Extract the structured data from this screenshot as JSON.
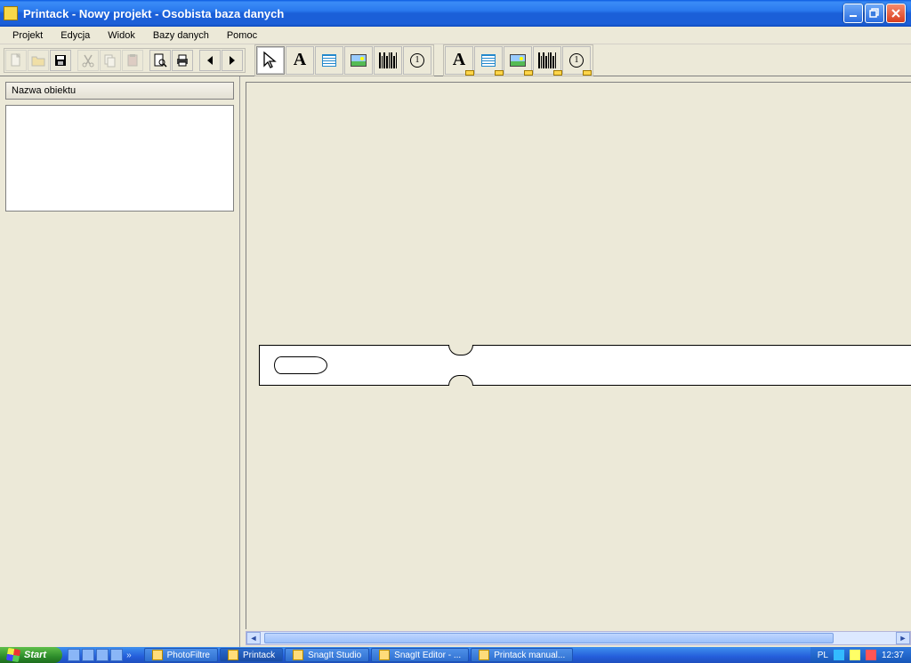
{
  "window": {
    "title": "Printack - Nowy projekt - Osobista baza danych"
  },
  "menu": {
    "items": [
      "Projekt",
      "Edycja",
      "Widok",
      "Bazy danych",
      "Pomoc"
    ]
  },
  "toolbar1": {
    "items": [
      {
        "name": "new-icon"
      },
      {
        "name": "open-icon"
      },
      {
        "name": "save-icon"
      },
      {
        "name": "cut-icon"
      },
      {
        "name": "copy-icon"
      },
      {
        "name": "paste-icon"
      },
      {
        "name": "preview-icon"
      },
      {
        "name": "print-icon"
      },
      {
        "name": "prev-icon"
      },
      {
        "name": "next-icon"
      }
    ]
  },
  "toolbar2": {
    "items": [
      {
        "name": "select-tool-icon",
        "selected": true
      },
      {
        "name": "text-tool-icon"
      },
      {
        "name": "textblock-tool-icon"
      },
      {
        "name": "image-tool-icon"
      },
      {
        "name": "barcode-tool-icon"
      },
      {
        "name": "sequence-tool-icon"
      }
    ]
  },
  "toolbar3": {
    "items": [
      {
        "name": "db-text-tool-icon"
      },
      {
        "name": "db-textblock-tool-icon"
      },
      {
        "name": "db-image-tool-icon"
      },
      {
        "name": "db-barcode-tool-icon"
      },
      {
        "name": "db-sequence-tool-icon"
      }
    ]
  },
  "sidebar": {
    "header": "Nazwa obiektu"
  },
  "taskbar": {
    "start": "Start",
    "tasks": [
      {
        "label": "PhotoFiltre"
      },
      {
        "label": "Printack",
        "active": true
      },
      {
        "label": "SnagIt Studio"
      },
      {
        "label": "SnagIt Editor - ..."
      },
      {
        "label": "Printack manual..."
      }
    ],
    "lang": "PL",
    "time": "12:37"
  }
}
